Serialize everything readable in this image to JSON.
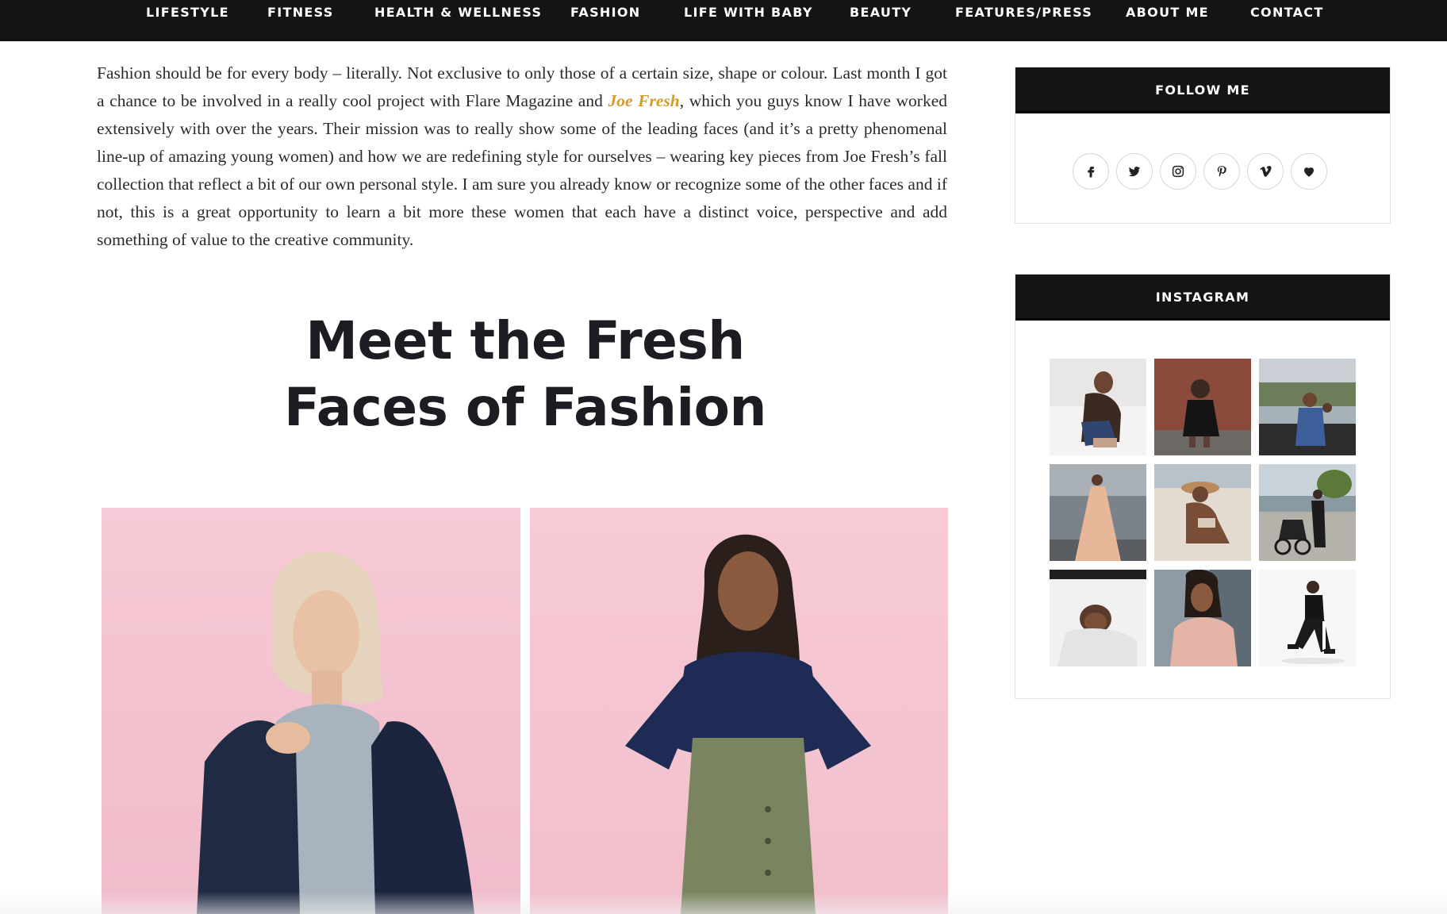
{
  "nav": {
    "items": [
      "LIFESTYLE",
      "FITNESS",
      "HEALTH & WELLNESS",
      "FASHION",
      "LIFE WITH BABY",
      "BEAUTY",
      "FEATURES/PRESS",
      "ABOUT ME",
      "CONTACT"
    ]
  },
  "article": {
    "intro_before_link": "Fashion should be for every body – literally. Not exclusive to only those of a certain size, shape or colour. Last month I got a chance to be involved in a really cool project with Flare Magazine and ",
    "link_text": "Joe Fresh",
    "intro_after_link": ", which you guys know I have worked extensively with over the years. Their mission was to really show some of the leading faces (and it’s a pretty phenomenal line-up of amazing young women) and how we are redefining style for ourselves – wearing key pieces from Joe Fresh’s fall collection that reflect a bit of our own personal style. I am sure you already know or recognize some of the other faces and if not, this is a great opportunity to learn a bit more these women that each have a distinct voice, perspective and add something of value to the creative community.",
    "headline_line1": "Meet the Fresh",
    "headline_line2": "Faces of Fashion"
  },
  "sidebar": {
    "follow_title": "FOLLOW ME",
    "socials": [
      "facebook-icon",
      "twitter-icon",
      "instagram-icon",
      "pinterest-icon",
      "vimeo-icon",
      "heart-icon"
    ],
    "instagram_title": "INSTAGRAM"
  },
  "colors": {
    "nav_bg": "#141414",
    "link": "#d49a2a",
    "headline": "#1c1c22",
    "photo_bg_pink": "#f4c4d0"
  }
}
